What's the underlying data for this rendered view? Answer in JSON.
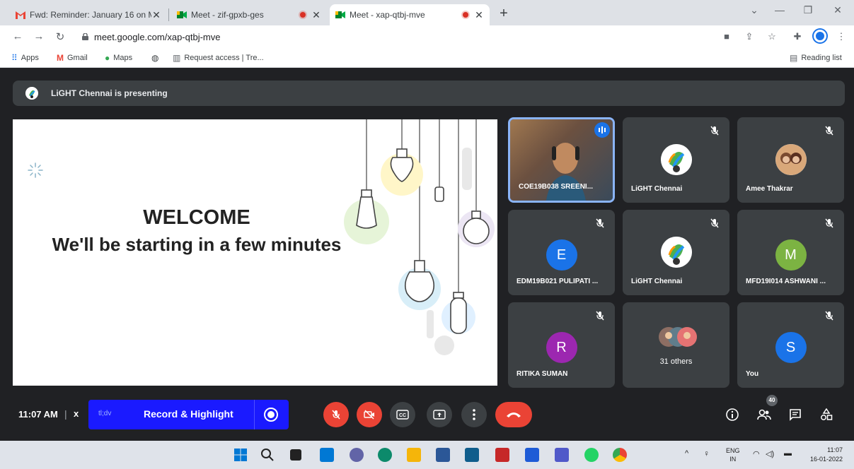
{
  "browser": {
    "tabs": [
      {
        "title": "Fwd: Reminder: January 16 on M",
        "icon": "gmail-icon"
      },
      {
        "title": "Meet - zif-gpxb-ges",
        "icon": "meet-icon",
        "recording": true
      },
      {
        "title": "Meet - xap-qtbj-mve",
        "icon": "meet-icon",
        "recording": true,
        "active": true
      }
    ],
    "url": "meet.google.com/xap-qtbj-mve",
    "bookmarks": [
      {
        "label": "Apps",
        "icon": "apps-grid-icon"
      },
      {
        "label": "Gmail",
        "icon": "gmail-icon"
      },
      {
        "label": "Maps",
        "icon": "maps-pin-icon"
      },
      {
        "label": "",
        "icon": "globe-icon"
      },
      {
        "label": "Request access | Tre...",
        "icon": "trello-icon"
      }
    ],
    "reading_list": "Reading list"
  },
  "meet": {
    "presenting_banner": "LiGHT Chennai is presenting",
    "slide": {
      "title": "WELCOME",
      "subtitle": "We'll be starting in a few minutes"
    },
    "participants": [
      {
        "name": "COE19B038 SREENI...",
        "type": "video",
        "speaking": true
      },
      {
        "name": "LiGHT Chennai",
        "type": "logo",
        "muted": true
      },
      {
        "name": "Amee Thakrar",
        "type": "photo",
        "muted": true
      },
      {
        "name": "EDM19B021 PULIPATI ...",
        "letter": "E",
        "color": "#1a73e8",
        "muted": true
      },
      {
        "name": "LiGHT Chennai",
        "type": "logo",
        "muted": true
      },
      {
        "name": "MFD19I014 ASHWANI ...",
        "letter": "M",
        "color": "#7cb342",
        "muted": true
      },
      {
        "name": "RITIKA SUMAN",
        "letter": "R",
        "color": "#9c27b0",
        "muted": true
      },
      {
        "name": "31 others",
        "type": "others"
      },
      {
        "name": "You",
        "letter": "S",
        "color": "#1a73e8",
        "muted": true
      }
    ],
    "bottom": {
      "time": "11:07 AM",
      "separator": "|",
      "close": "x",
      "ext_label": "tl;dv",
      "record_label": "Record & Highlight",
      "people_count": "40"
    }
  },
  "taskbar": {
    "lang_top": "ENG",
    "lang_bottom": "IN",
    "time": "11:07",
    "date": "16-01-2022"
  }
}
